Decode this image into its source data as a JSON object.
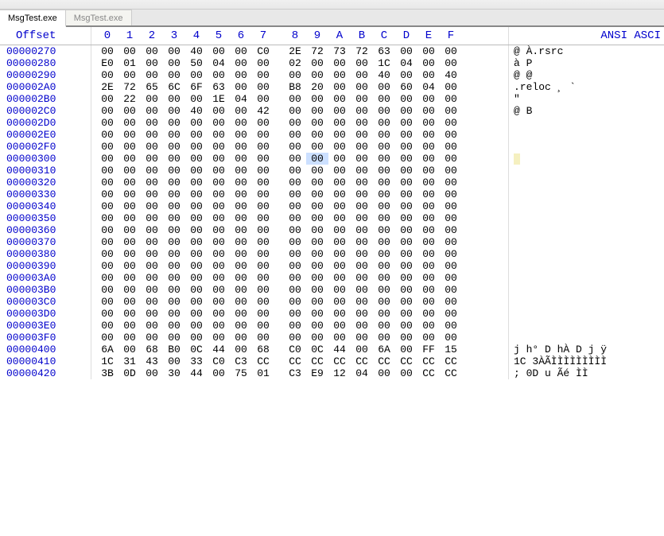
{
  "tabs": [
    {
      "label": "MsgTest.exe",
      "active": true
    },
    {
      "label": "MsgTest.exe",
      "active": false
    }
  ],
  "header": {
    "offset_label": "Offset",
    "cols": [
      "0",
      "1",
      "2",
      "3",
      "4",
      "5",
      "6",
      "7",
      "8",
      "9",
      "A",
      "B",
      "C",
      "D",
      "E",
      "F"
    ],
    "ascii_label": "ANSI ASCI"
  },
  "rows": [
    {
      "off": "00000270",
      "hex": [
        "00",
        "00",
        "00",
        "00",
        "40",
        "00",
        "00",
        "C0",
        "2E",
        "72",
        "73",
        "72",
        "63",
        "00",
        "00",
        "00"
      ],
      "ascii": "    @  À.rsrc   "
    },
    {
      "off": "00000280",
      "hex": [
        "E0",
        "01",
        "00",
        "00",
        "50",
        "04",
        "00",
        "00",
        "02",
        "00",
        "00",
        "00",
        "1C",
        "04",
        "00",
        "00"
      ],
      "ascii": "à   P           "
    },
    {
      "off": "00000290",
      "hex": [
        "00",
        "00",
        "00",
        "00",
        "00",
        "00",
        "00",
        "00",
        "00",
        "00",
        "00",
        "00",
        "40",
        "00",
        "00",
        "40"
      ],
      "ascii": "            @  @"
    },
    {
      "off": "000002A0",
      "hex": [
        "2E",
        "72",
        "65",
        "6C",
        "6F",
        "63",
        "00",
        "00",
        "B8",
        "20",
        "00",
        "00",
        "00",
        "60",
        "04",
        "00"
      ],
      "ascii": ".reloc  ¸    `  "
    },
    {
      "off": "000002B0",
      "hex": [
        "00",
        "22",
        "00",
        "00",
        "00",
        "1E",
        "04",
        "00",
        "00",
        "00",
        "00",
        "00",
        "00",
        "00",
        "00",
        "00"
      ],
      "ascii": " \"              "
    },
    {
      "off": "000002C0",
      "hex": [
        "00",
        "00",
        "00",
        "00",
        "40",
        "00",
        "00",
        "42",
        "00",
        "00",
        "00",
        "00",
        "00",
        "00",
        "00",
        "00"
      ],
      "ascii": "    @  B        "
    },
    {
      "off": "000002D0",
      "hex": [
        "00",
        "00",
        "00",
        "00",
        "00",
        "00",
        "00",
        "00",
        "00",
        "00",
        "00",
        "00",
        "00",
        "00",
        "00",
        "00"
      ],
      "ascii": "                "
    },
    {
      "off": "000002E0",
      "hex": [
        "00",
        "00",
        "00",
        "00",
        "00",
        "00",
        "00",
        "00",
        "00",
        "00",
        "00",
        "00",
        "00",
        "00",
        "00",
        "00"
      ],
      "ascii": "                "
    },
    {
      "off": "000002F0",
      "hex": [
        "00",
        "00",
        "00",
        "00",
        "00",
        "00",
        "00",
        "00",
        "00",
        "00",
        "00",
        "00",
        "00",
        "00",
        "00",
        "00"
      ],
      "ascii": "                "
    },
    {
      "off": "00000300",
      "hex": [
        "00",
        "00",
        "00",
        "00",
        "00",
        "00",
        "00",
        "00",
        "00",
        "00",
        "00",
        "00",
        "00",
        "00",
        "00",
        "00"
      ],
      "ascii": "                ",
      "sel": 9,
      "cursor": true
    },
    {
      "off": "00000310",
      "hex": [
        "00",
        "00",
        "00",
        "00",
        "00",
        "00",
        "00",
        "00",
        "00",
        "00",
        "00",
        "00",
        "00",
        "00",
        "00",
        "00"
      ],
      "ascii": "                "
    },
    {
      "off": "00000320",
      "hex": [
        "00",
        "00",
        "00",
        "00",
        "00",
        "00",
        "00",
        "00",
        "00",
        "00",
        "00",
        "00",
        "00",
        "00",
        "00",
        "00"
      ],
      "ascii": "                "
    },
    {
      "off": "00000330",
      "hex": [
        "00",
        "00",
        "00",
        "00",
        "00",
        "00",
        "00",
        "00",
        "00",
        "00",
        "00",
        "00",
        "00",
        "00",
        "00",
        "00"
      ],
      "ascii": "                "
    },
    {
      "off": "00000340",
      "hex": [
        "00",
        "00",
        "00",
        "00",
        "00",
        "00",
        "00",
        "00",
        "00",
        "00",
        "00",
        "00",
        "00",
        "00",
        "00",
        "00"
      ],
      "ascii": "                "
    },
    {
      "off": "00000350",
      "hex": [
        "00",
        "00",
        "00",
        "00",
        "00",
        "00",
        "00",
        "00",
        "00",
        "00",
        "00",
        "00",
        "00",
        "00",
        "00",
        "00"
      ],
      "ascii": "                "
    },
    {
      "off": "00000360",
      "hex": [
        "00",
        "00",
        "00",
        "00",
        "00",
        "00",
        "00",
        "00",
        "00",
        "00",
        "00",
        "00",
        "00",
        "00",
        "00",
        "00"
      ],
      "ascii": "                "
    },
    {
      "off": "00000370",
      "hex": [
        "00",
        "00",
        "00",
        "00",
        "00",
        "00",
        "00",
        "00",
        "00",
        "00",
        "00",
        "00",
        "00",
        "00",
        "00",
        "00"
      ],
      "ascii": "                "
    },
    {
      "off": "00000380",
      "hex": [
        "00",
        "00",
        "00",
        "00",
        "00",
        "00",
        "00",
        "00",
        "00",
        "00",
        "00",
        "00",
        "00",
        "00",
        "00",
        "00"
      ],
      "ascii": "                "
    },
    {
      "off": "00000390",
      "hex": [
        "00",
        "00",
        "00",
        "00",
        "00",
        "00",
        "00",
        "00",
        "00",
        "00",
        "00",
        "00",
        "00",
        "00",
        "00",
        "00"
      ],
      "ascii": "                "
    },
    {
      "off": "000003A0",
      "hex": [
        "00",
        "00",
        "00",
        "00",
        "00",
        "00",
        "00",
        "00",
        "00",
        "00",
        "00",
        "00",
        "00",
        "00",
        "00",
        "00"
      ],
      "ascii": "                "
    },
    {
      "off": "000003B0",
      "hex": [
        "00",
        "00",
        "00",
        "00",
        "00",
        "00",
        "00",
        "00",
        "00",
        "00",
        "00",
        "00",
        "00",
        "00",
        "00",
        "00"
      ],
      "ascii": "                "
    },
    {
      "off": "000003C0",
      "hex": [
        "00",
        "00",
        "00",
        "00",
        "00",
        "00",
        "00",
        "00",
        "00",
        "00",
        "00",
        "00",
        "00",
        "00",
        "00",
        "00"
      ],
      "ascii": "                "
    },
    {
      "off": "000003D0",
      "hex": [
        "00",
        "00",
        "00",
        "00",
        "00",
        "00",
        "00",
        "00",
        "00",
        "00",
        "00",
        "00",
        "00",
        "00",
        "00",
        "00"
      ],
      "ascii": "                "
    },
    {
      "off": "000003E0",
      "hex": [
        "00",
        "00",
        "00",
        "00",
        "00",
        "00",
        "00",
        "00",
        "00",
        "00",
        "00",
        "00",
        "00",
        "00",
        "00",
        "00"
      ],
      "ascii": "                "
    },
    {
      "off": "000003F0",
      "hex": [
        "00",
        "00",
        "00",
        "00",
        "00",
        "00",
        "00",
        "00",
        "00",
        "00",
        "00",
        "00",
        "00",
        "00",
        "00",
        "00"
      ],
      "ascii": "                "
    },
    {
      "off": "00000400",
      "hex": [
        "6A",
        "00",
        "68",
        "B0",
        "0C",
        "44",
        "00",
        "68",
        "C0",
        "0C",
        "44",
        "00",
        "6A",
        "00",
        "FF",
        "15"
      ],
      "ascii": "j h° D hÀ D j ÿ "
    },
    {
      "off": "00000410",
      "hex": [
        "1C",
        "31",
        "43",
        "00",
        "33",
        "C0",
        "C3",
        "CC",
        "CC",
        "CC",
        "CC",
        "CC",
        "CC",
        "CC",
        "CC",
        "CC"
      ],
      "ascii": " 1C 3ÀÃÌÌÌÌÌÌÌÌÌ"
    },
    {
      "off": "00000420",
      "hex": [
        "3B",
        "0D",
        "00",
        "30",
        "44",
        "00",
        "75",
        "01",
        "C3",
        "E9",
        "12",
        "04",
        "00",
        "00",
        "CC",
        "CC"
      ],
      "ascii": ";  0D u Ãé    ÌÌ"
    }
  ]
}
